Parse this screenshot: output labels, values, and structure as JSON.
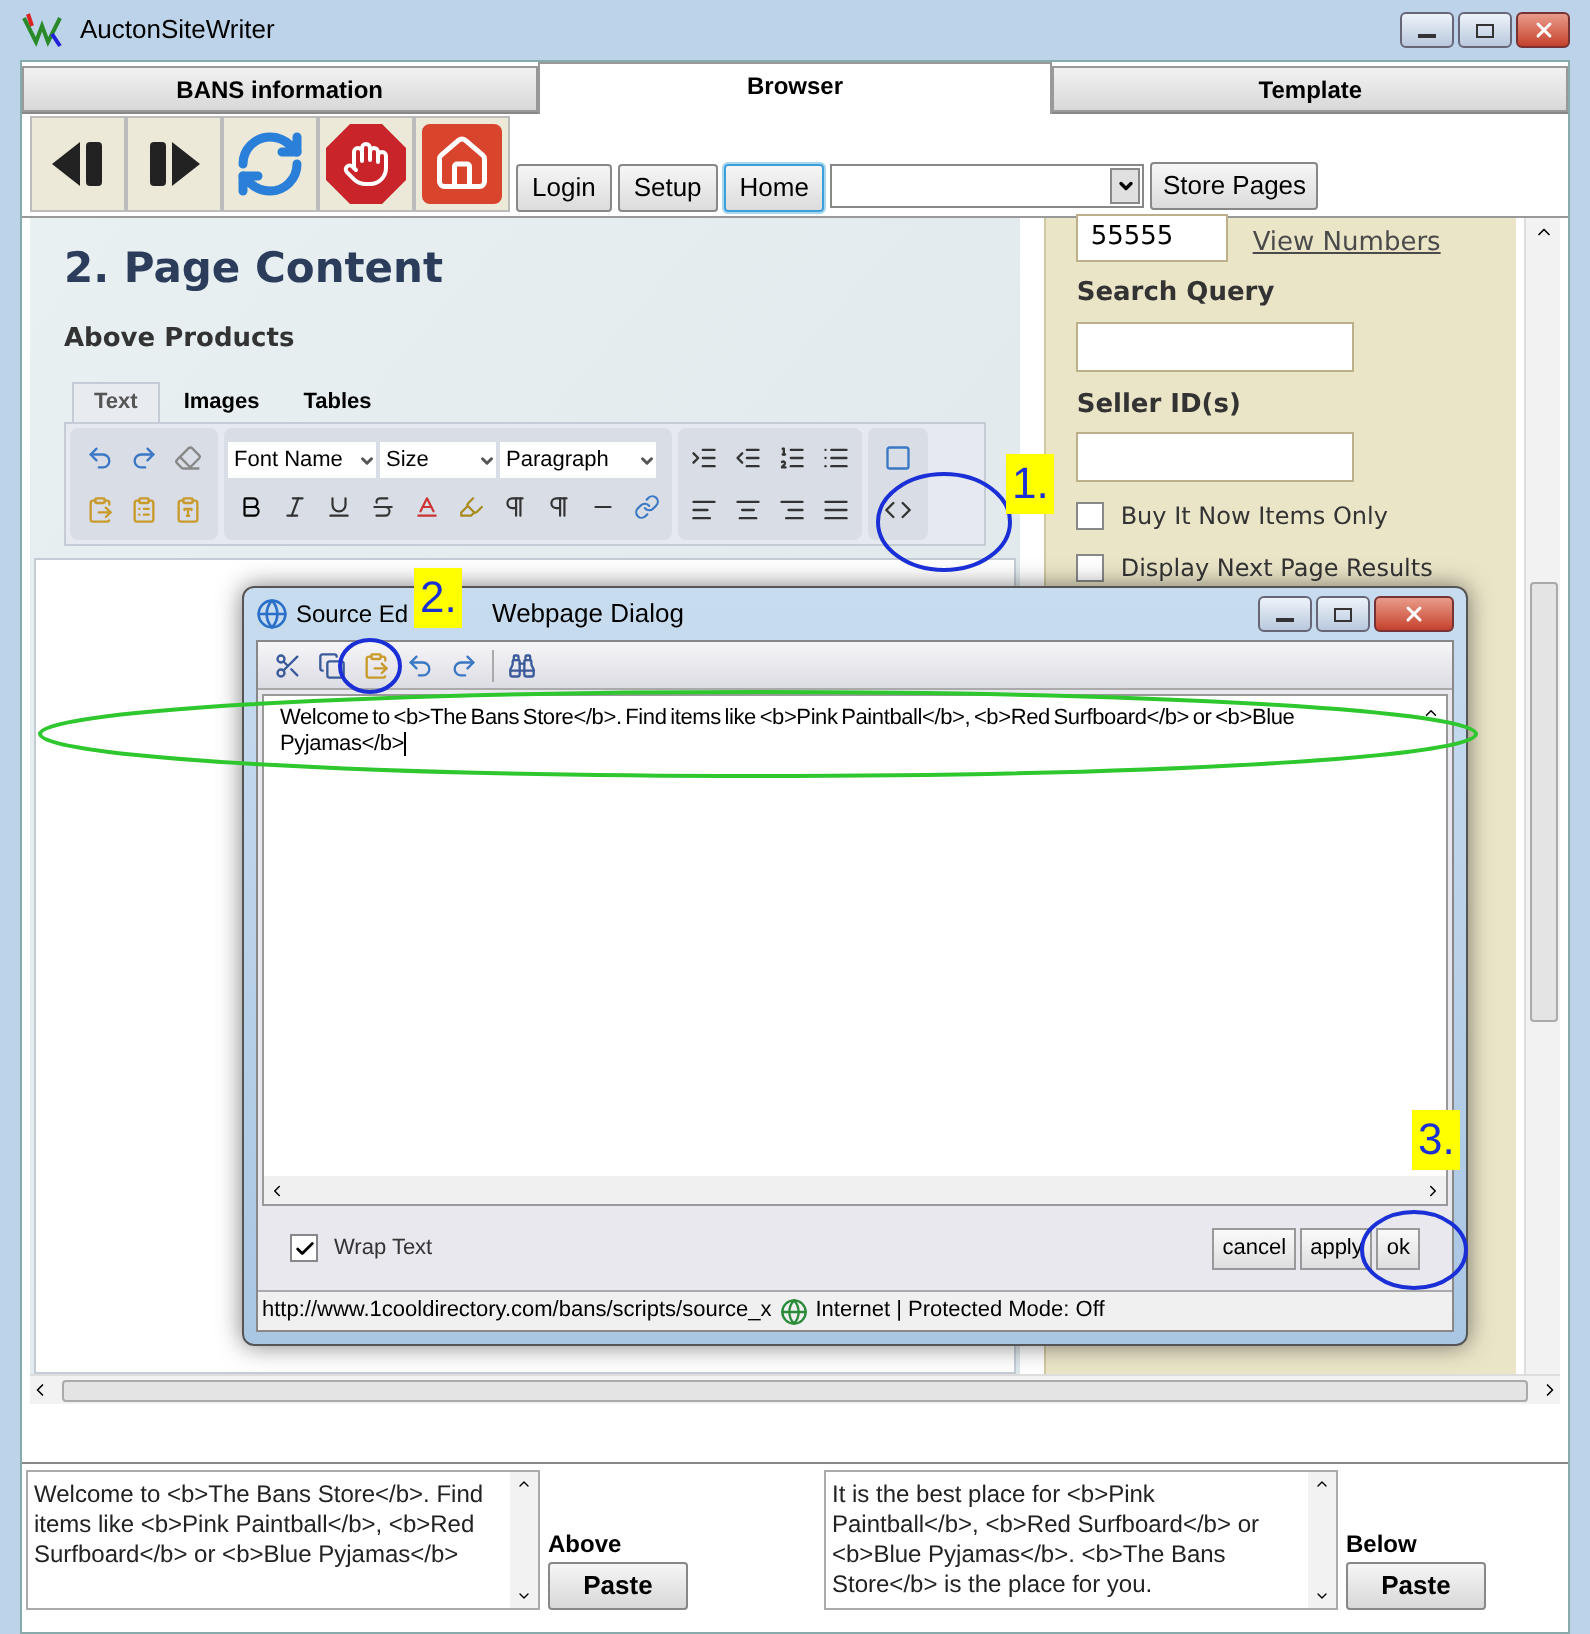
{
  "window": {
    "title": "AuctonSiteWriter"
  },
  "tabs": [
    {
      "label": "BANS information",
      "selected": false
    },
    {
      "label": "Browser",
      "selected": true
    },
    {
      "label": "Template",
      "selected": false
    }
  ],
  "toolbar": {
    "buttons": [
      {
        "label": "Login",
        "selected": false
      },
      {
        "label": "Setup",
        "selected": false
      },
      {
        "label": "Home",
        "selected": true
      }
    ],
    "store_pages": "Store Pages"
  },
  "page": {
    "heading": "2. Page Content",
    "subheading": "Above Products",
    "editor_tabs": [
      {
        "label": "Text",
        "selected": true
      },
      {
        "label": "Images",
        "selected": false
      },
      {
        "label": "Tables",
        "selected": false
      }
    ],
    "selects": [
      "Font Name",
      "Size",
      "Paragraph"
    ]
  },
  "side": {
    "number": "55555",
    "link": "View Numbers",
    "search_label": "Search Query",
    "seller_label": "Seller ID(s)",
    "checks": [
      {
        "label": "Buy It Now Items Only",
        "checked": false
      },
      {
        "label": "Display Next Page Results",
        "checked": false
      }
    ]
  },
  "dialog": {
    "title_start": "Source Ed",
    "title_end": "Webpage Dialog",
    "text": "Welcome to <b>The Bans Store</b>. Find items like <b>Pink Paintball</b>, <b>Red Surfboard</b> or <b>Blue Pyjamas</b>",
    "wrap": {
      "label": "Wrap Text",
      "checked": true
    },
    "buttons": [
      "cancel",
      "apply",
      "ok"
    ],
    "url": "http://www.1cooldirectory.com/bans/scripts/source_x",
    "zone": "Internet | Protected Mode: Off"
  },
  "callouts": [
    "1.",
    "2.",
    "3."
  ],
  "bottom": [
    {
      "text": "Welcome to <b>The Bans Store</b>. Find items like <b>Pink Paintball</b>, <b>Red Surfboard</b> or <b>Blue Pyjamas</b>",
      "label": "Above",
      "button": "Paste"
    },
    {
      "text": "It is the best place for <b>Pink Paintball</b>, <b>Red Surfboard</b> or <b>Blue Pyjamas</b>. <b>The Bans Store</b> is the place for you.",
      "label": "Below",
      "button": "Paste"
    }
  ]
}
